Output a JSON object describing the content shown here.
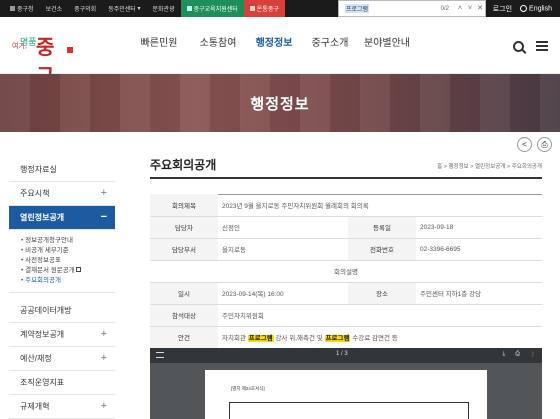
{
  "topbar": {
    "links": [
      "중구청",
      "보건소",
      "중구의회",
      "동주민센터",
      "문화관광",
      "중구교육지원센터",
      "온통중구"
    ],
    "login": "로그인",
    "english": "English"
  },
  "findbar": {
    "query": "프로그램",
    "count": "0/2"
  },
  "header": {
    "logo_text": "중구",
    "nav": [
      "빠른민원",
      "소통참여",
      "행정정보",
      "중구소개",
      "분야별안내"
    ],
    "active_nav": "행정정보"
  },
  "banner": {
    "title": "행정정보"
  },
  "sidebar": {
    "items": [
      {
        "label": "행정자료실",
        "toggle": ""
      },
      {
        "label": "주요시책",
        "toggle": "+"
      },
      {
        "label": "열린정보공개",
        "toggle": "−"
      }
    ],
    "sub": [
      "정보공개청구안내",
      "비공개 세부기준",
      "사전정보공표",
      "결재문서 원문공개",
      "주요회의공개"
    ],
    "items2": [
      {
        "label": "공공데이터개방",
        "toggle": ""
      },
      {
        "label": "계약정보공개",
        "toggle": "+"
      },
      {
        "label": "예산/재정",
        "toggle": "+"
      },
      {
        "label": "조직운영지표",
        "toggle": ""
      },
      {
        "label": "규제개혁",
        "toggle": "+"
      }
    ]
  },
  "content": {
    "title": "주요회의공개",
    "breadcrumb": "홈 > 행정정보 > 열린정보공개 > 주요회의공개",
    "rows": {
      "title_label": "회의제목",
      "title_value": "2023년 9월 을지로동 주민자치위원회 월례회의 회의록",
      "owner_label": "담당자",
      "owner_value": "신정인",
      "reg_label": "등록일",
      "reg_value": "2023-09-18",
      "dept_label": "담당부서",
      "dept_value": "을지로동",
      "phone_label": "전화번호",
      "phone_value": "02-3396-6695",
      "desc_label": "회의설명",
      "date_label": "일시",
      "date_value": "2023-09-14(목) 16:00",
      "place_label": "장소",
      "place_value": "주민센터 지하1층 강당",
      "attend_label": "참석대상",
      "attend_value": "주민자치위원회",
      "agenda_label": "안건",
      "agenda_pre": "자치회관",
      "agenda_hl1": "프로그램",
      "agenda_mid": "강사 위,해촉건 및",
      "agenda_hl2": "프로그램",
      "agenda_post": "수강료 감면건 등"
    }
  },
  "pdf": {
    "page": "1 / 3",
    "doc_label": "[별지 제24호서식]"
  }
}
